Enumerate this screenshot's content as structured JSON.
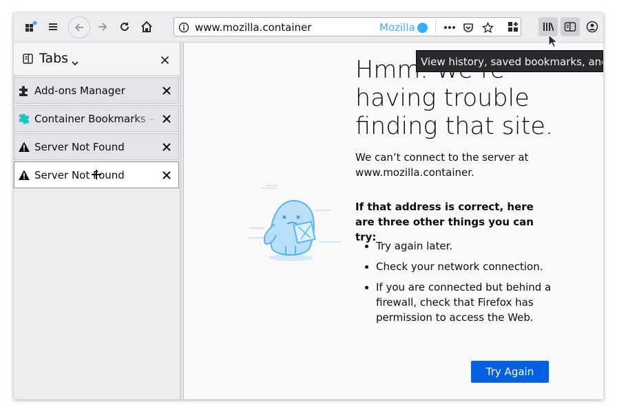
{
  "toolbar": {
    "url": "www.mozilla.container",
    "container_name": "Mozilla",
    "container_color": "#37adff",
    "icons": [
      "containers-icon",
      "menu-icon",
      "back-icon",
      "forward-icon",
      "reload-icon",
      "home-icon",
      "info-icon",
      "page-actions-icon",
      "pocket-icon",
      "bookmark-star-icon",
      "extensions-icon",
      "library-icon",
      "sidebar-icon",
      "account-icon"
    ]
  },
  "sidebar": {
    "title": "Tabs",
    "tabs": [
      {
        "label": "Add-ons Manager",
        "icon": "puzzle-icon"
      },
      {
        "label": "Container Bookmarks – G",
        "icon": "container-bookmarks-icon"
      },
      {
        "label": "Server Not Found",
        "icon": "warning-icon"
      },
      {
        "label": "Server Not Found",
        "icon": "warning-icon",
        "active": true
      }
    ]
  },
  "error_page": {
    "title": "Hmm. We’re having trouble finding that site.",
    "message": "We can’t connect to the server at www.mozilla.container.",
    "suggestion_heading": "If that address is correct, here are three other things you can try:",
    "suggestions": [
      "Try again later.",
      "Check your network connection.",
      "If you are connected but behind a firewall, check that Firefox has permission to access the Web."
    ],
    "button_label": "Try Again",
    "button_color": "#0060df"
  },
  "tooltip": "View history, saved bookmarks, and more"
}
